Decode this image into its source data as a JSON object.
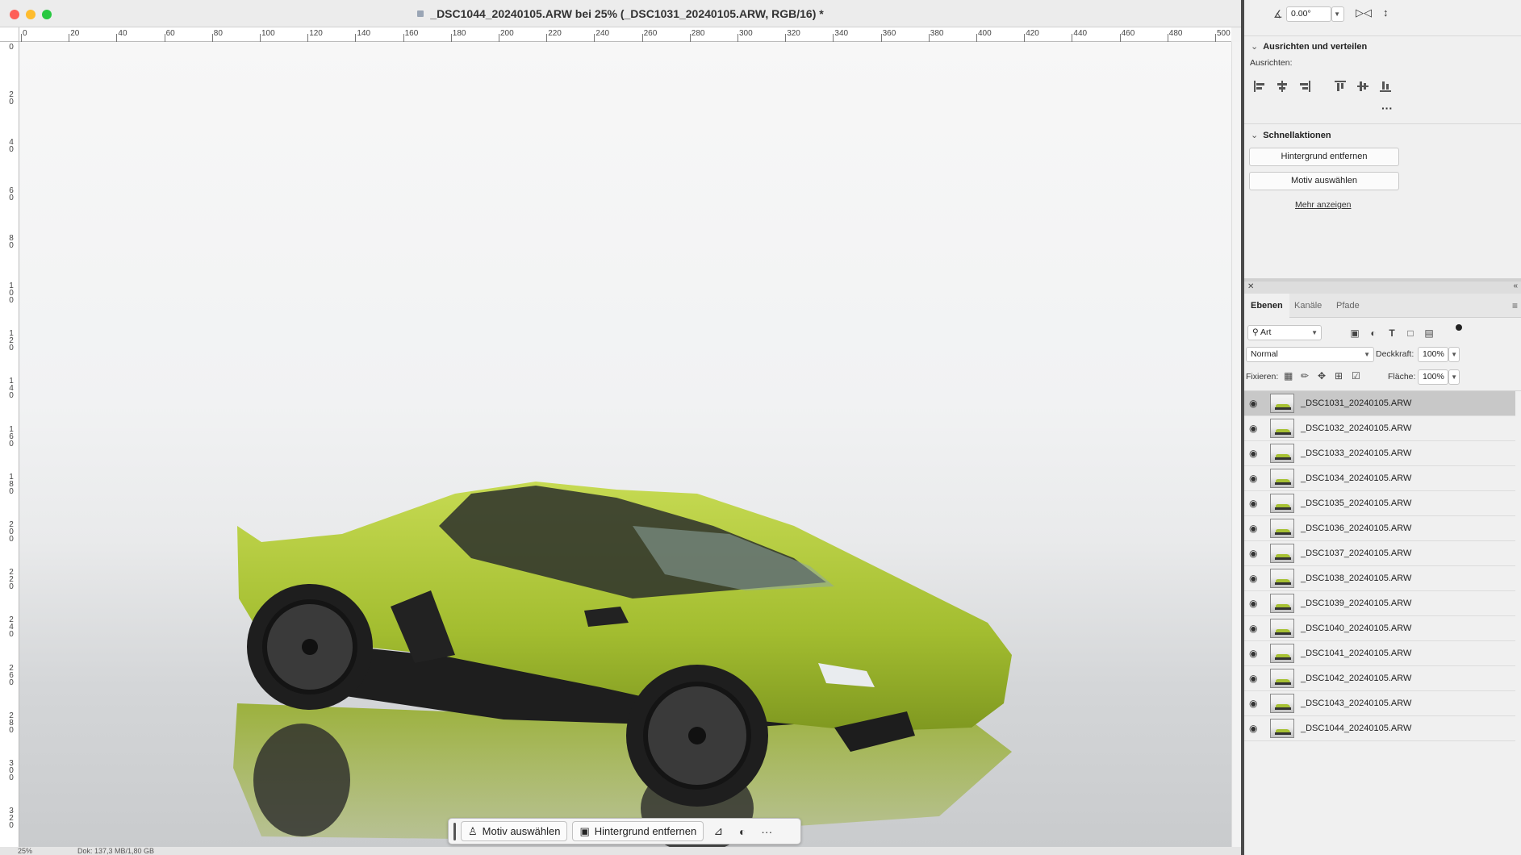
{
  "document": {
    "title": "_DSC1044_20240105.ARW bei 25% (_DSC1031_20240105.ARW, RGB/16) *",
    "status_zoom": "25%",
    "status_info": "Dok: 137,3 MB/1,80 GB",
    "ruler_h": [
      "0",
      "20",
      "40",
      "60",
      "80",
      "100",
      "120",
      "140",
      "160",
      "180",
      "200",
      "220",
      "240",
      "260",
      "280",
      "300",
      "320",
      "340",
      "360",
      "380",
      "400",
      "420",
      "440",
      "460",
      "480",
      "500"
    ],
    "ruler_v": [
      "0",
      "20",
      "40",
      "60",
      "80",
      "100",
      "120",
      "140",
      "160",
      "180",
      "200",
      "220",
      "240",
      "260",
      "280",
      "300",
      "320"
    ]
  },
  "contextual_taskbar": {
    "select_subject": "Motiv auswählen",
    "remove_background": "Hintergrund entfernen",
    "more_icon": "···"
  },
  "properties": {
    "angle_value": "0.00°",
    "align_section": "Ausrichten und verteilen",
    "align_label": "Ausrichten:",
    "align_more": "···",
    "quick_actions_section": "Schnellaktionen",
    "remove_background": "Hintergrund entfernen",
    "select_subject": "Motiv auswählen",
    "show_more": "Mehr anzeigen"
  },
  "layers_panel": {
    "tabs": [
      "Ebenen",
      "Kanäle",
      "Pfade"
    ],
    "active_tab": "Ebenen",
    "filter_kind": "Art",
    "blend_mode": "Normal",
    "opacity_label": "Deckkraft:",
    "opacity_value": "100%",
    "lock_label": "Fixieren:",
    "fill_label": "Fläche:",
    "fill_value": "100%",
    "layers": [
      "_DSC1031_20240105.ARW",
      "_DSC1032_20240105.ARW",
      "_DSC1033_20240105.ARW",
      "_DSC1034_20240105.ARW",
      "_DSC1035_20240105.ARW",
      "_DSC1036_20240105.ARW",
      "_DSC1037_20240105.ARW",
      "_DSC1038_20240105.ARW",
      "_DSC1039_20240105.ARW",
      "_DSC1040_20240105.ARW",
      "_DSC1041_20240105.ARW",
      "_DSC1042_20240105.ARW",
      "_DSC1043_20240105.ARW",
      "_DSC1044_20240105.ARW"
    ],
    "selected_layer": "_DSC1031_20240105.ARW"
  },
  "colors": {
    "car": "#a7c133",
    "selected_layer": "#c8c8c8",
    "close": "#fe5f57",
    "minimize": "#febc2e",
    "maximize": "#28c840"
  }
}
